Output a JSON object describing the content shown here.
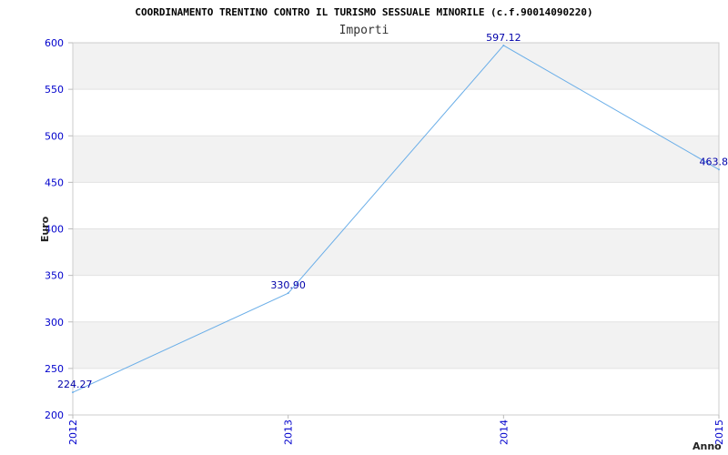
{
  "chart_data": {
    "type": "line",
    "title": "COORDINAMENTO TRENTINO CONTRO IL TURISMO SESSUALE MINORILE (c.f.90014090220)",
    "subtitle": "Importi",
    "xlabel": "Anno",
    "ylabel": "Euro",
    "x": [
      "2012",
      "2013",
      "2014",
      "2015"
    ],
    "series": [
      {
        "values": [
          224.27,
          330.9,
          597.12,
          463.8
        ]
      }
    ],
    "data_labels": [
      "224.27",
      "330.90",
      "597.12",
      "463.8"
    ],
    "ylim": [
      200,
      600
    ],
    "yticks": [
      "200",
      "250",
      "300",
      "350",
      "400",
      "450",
      "500",
      "550",
      "600"
    ],
    "grid": true,
    "colors": {
      "line": "#6aaee8",
      "band": "#f2f2f2",
      "tick_text": "#0000cc",
      "data_label_text": "#0000aa"
    }
  }
}
